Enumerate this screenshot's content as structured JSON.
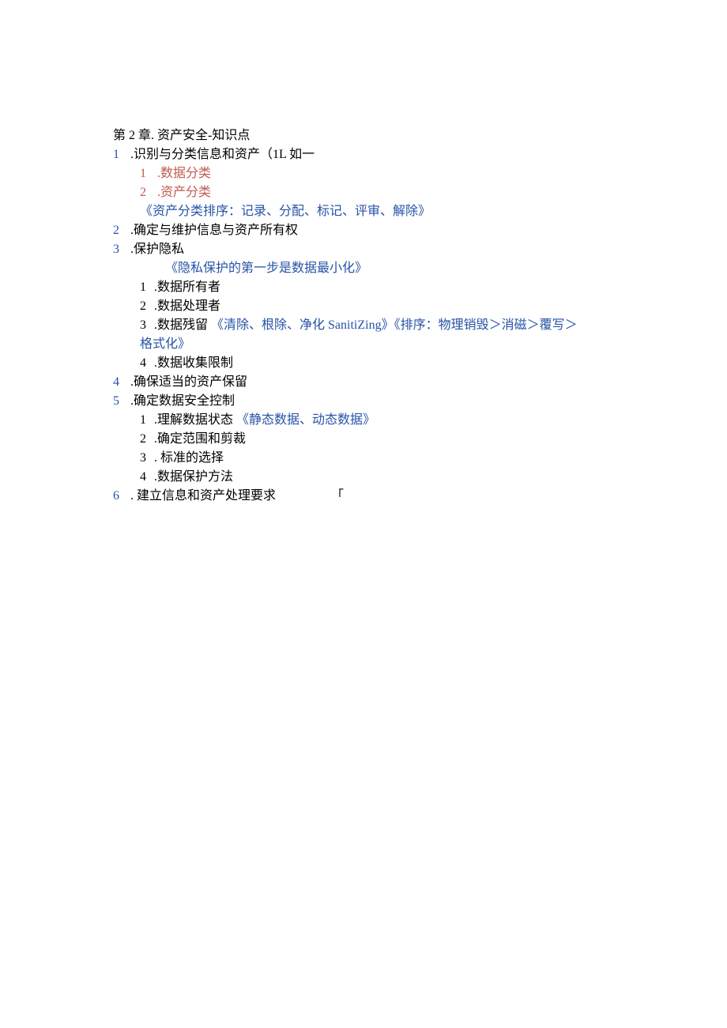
{
  "title": "第 2 章. 资产安全-知识点",
  "items": [
    {
      "num": "1",
      "label": ".识别与分类信息和资产（1L 如一",
      "children": [
        {
          "num": "1",
          "label": ".数据分类",
          "style": "red"
        },
        {
          "num": "2",
          "label": ".资产分类",
          "style": "red"
        },
        {
          "note": "《资产分类排序：记录、分配、标记、评审、解除》"
        }
      ]
    },
    {
      "num": "2",
      "label": ".确定与维护信息与资产所有权"
    },
    {
      "num": "3",
      "label": ".保护隐私",
      "leading_note": "《隐私保护的第一步是数据最小化》",
      "children": [
        {
          "num": "1",
          "label": ".数据所有者"
        },
        {
          "num": "2",
          "label": ".数据处理者"
        },
        {
          "num": "3",
          "label": ".数据残留",
          "inline_note": "《清除、根除、净化 SanitiZing》《排序：物理销毁＞消磁＞覆写＞",
          "wrap_note": "格式化》"
        },
        {
          "num": "4",
          "label": ".数据收集限制"
        }
      ]
    },
    {
      "num": "4",
      "label": ".确保适当的资产保留"
    },
    {
      "num": "5",
      "label": ".确定数据安全控制",
      "children": [
        {
          "num": "1",
          "label": ".理解数据状态",
          "inline_note": "《静态数据、动态数据》"
        },
        {
          "num": "2",
          "label": ".确定范围和剪裁"
        },
        {
          "num": "3",
          "label": ". 标准的选择"
        },
        {
          "num": "4",
          "label": ".数据保护方法"
        }
      ]
    },
    {
      "num": "6",
      "label": ". 建立信息和资产处理要求",
      "cursor": "「"
    }
  ]
}
